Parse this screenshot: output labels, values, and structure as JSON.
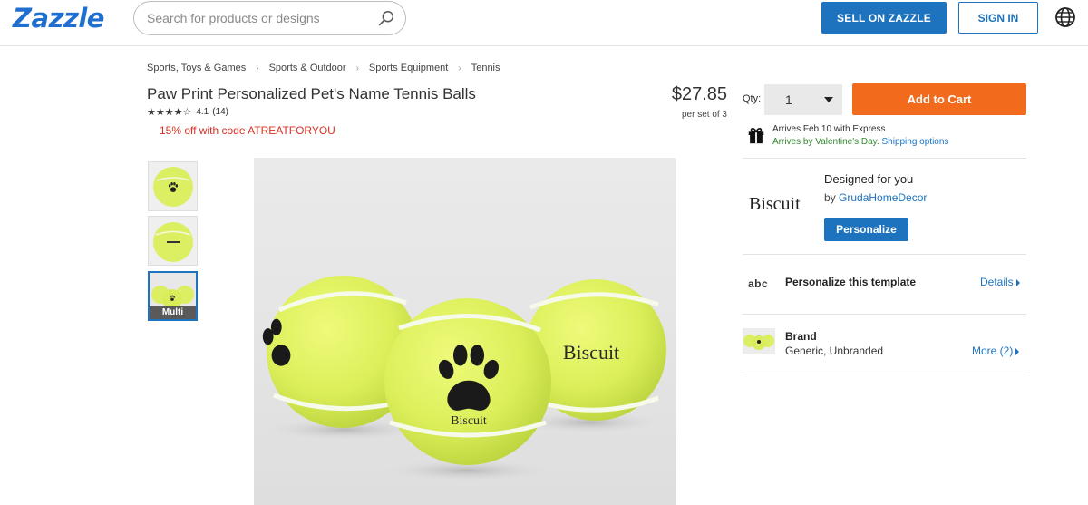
{
  "header": {
    "logo": "Zazzle",
    "search_placeholder": "Search for products or designs",
    "sell_label": "SELL ON ZAZZLE",
    "signin_label": "SIGN IN"
  },
  "breadcrumb": [
    "Sports, Toys & Games",
    "Sports & Outdoor",
    "Sports Equipment",
    "Tennis"
  ],
  "product": {
    "title": "Paw Print Personalized Pet's Name Tennis Balls",
    "stars": "★★★★☆",
    "rating": "4.1",
    "review_count": "(14)",
    "promo": "15% off with code ATREATFORYOU",
    "price": "$27.85",
    "price_unit": "per set of 3",
    "image_text": "Biscuit"
  },
  "thumbnails": [
    {
      "label": ""
    },
    {
      "label": ""
    },
    {
      "label": "Multi"
    }
  ],
  "purchase": {
    "qty_label": "Qty:",
    "qty_value": "1",
    "add_to_cart": "Add to Cart",
    "arrives": "Arrives Feb 10 with Express",
    "valentine": "Arrives by Valentine's Day.",
    "shipping_link": "Shipping options"
  },
  "design": {
    "preview_text": "Biscuit",
    "heading": "Designed for you",
    "by_prefix": "by ",
    "designer": "GrudaHomeDecor",
    "personalize_button": "Personalize"
  },
  "template": {
    "icon_text": "abc",
    "label": "Personalize this template",
    "details": "Details"
  },
  "brand": {
    "label": "Brand",
    "value": "Generic, Unbranded",
    "more": "More (2)"
  },
  "colors": {
    "brand_blue": "#1e73be",
    "cart_orange": "#f26a1b",
    "promo_red": "#d93025",
    "ball_yellow": "#dff266"
  }
}
